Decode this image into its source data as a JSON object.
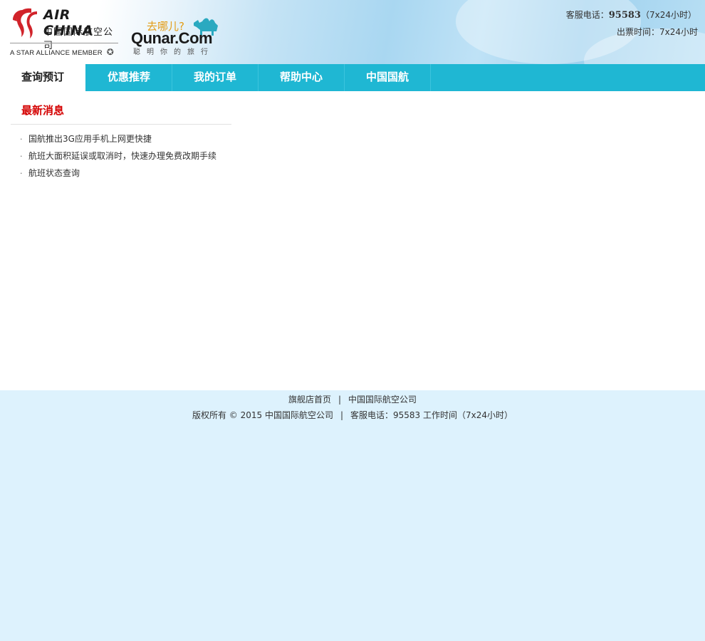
{
  "header": {
    "airchina_name": "AIR CHINA",
    "airchina_cn": "中国国际航空公司",
    "star_alliance": "A STAR ALLIANCE MEMBER",
    "qunar_cn": "去哪儿?",
    "qunar_en": "Qunar.Com",
    "qunar_tagline": "聪明你的旅行",
    "phone_label": "客服电话：",
    "phone_number": "95583",
    "phone_hours": "（7x24小时）",
    "ticket_time": "出票时间：7x24小时"
  },
  "nav": {
    "items": [
      {
        "label": "查询预订"
      },
      {
        "label": "优惠推荐"
      },
      {
        "label": "我的订单"
      },
      {
        "label": "帮助中心"
      },
      {
        "label": "中国国航"
      }
    ]
  },
  "news": {
    "title": "最新消息",
    "items": [
      {
        "text": "国航推出3G应用手机上网更快捷"
      },
      {
        "text": "航班大面积延误或取消时，快速办理免费改期手续"
      },
      {
        "text": "航班状态查询"
      }
    ]
  },
  "footer": {
    "link_home": "旗舰店首页",
    "link_separator": "|",
    "link_company": "中国国际航空公司",
    "copyright": "版权所有 © 2015 中国国际航空公司",
    "service": "客服电话：95583 工作时间（7x24小时）"
  },
  "colors": {
    "nav_bg": "#1fb7d3",
    "news_title": "#d40000",
    "footer_bg": "#ddf2fd",
    "airchina_red": "#d1232a",
    "qunar_teal": "#2aa9c0"
  }
}
